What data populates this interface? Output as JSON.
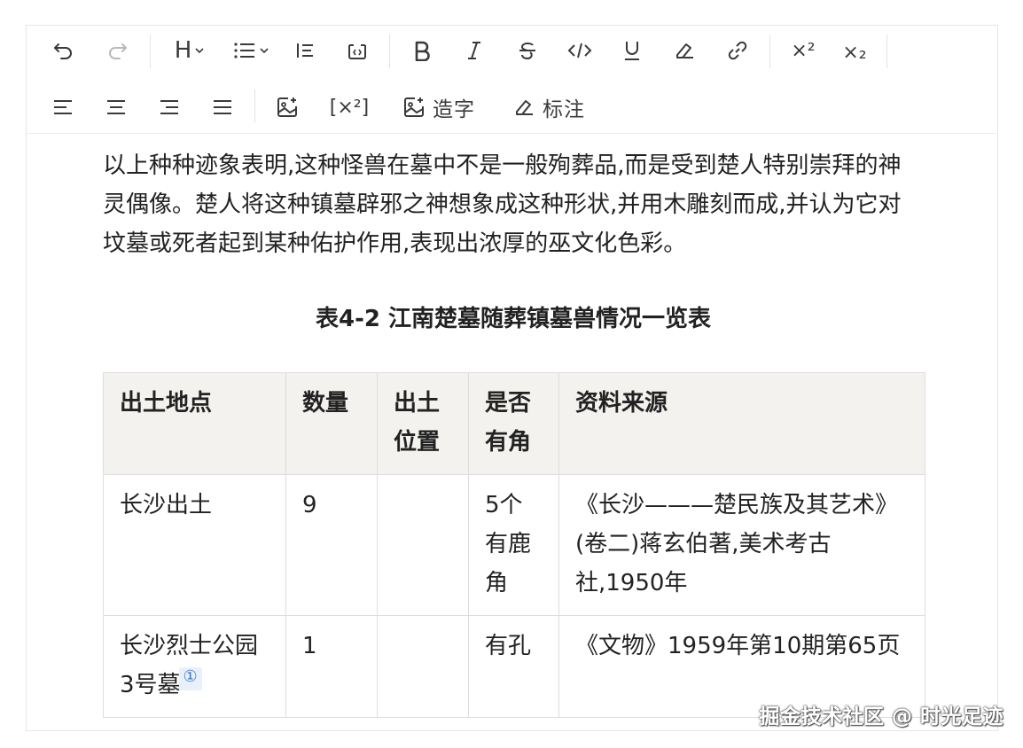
{
  "toolbar": {
    "row2": {
      "insert_formula": "[×²]",
      "make_char_label": "造字",
      "annotate_label": "标注"
    },
    "superscript": "×²",
    "subscript": "×₂",
    "heading": "H"
  },
  "content": {
    "paragraph": "以上种种迹象表明,这种怪兽在墓中不是一般殉葬品,而是受到楚人特别崇拜的神灵偶像。楚人将这种镇墓辟邪之神想象成这种形状,并用木雕刻而成,并认为它对坟墓或死者起到某种佑护作用,表现出浓厚的巫文化色彩。",
    "table_title": "表4-2 江南楚墓随葬镇墓兽情况一览表",
    "table": {
      "headers": [
        "出土地点",
        "数量",
        "出土位置",
        "是否有角",
        "资料来源"
      ],
      "rows": [
        [
          "长沙出土",
          "9",
          "",
          "5个有鹿角",
          "《长沙———楚民族及其艺术》(卷二)蒋玄伯著,美术考古社,1950年"
        ],
        [
          "长沙烈士公园3号墓",
          "1",
          "",
          "有孔",
          "《文物》1959年第10期第65页"
        ]
      ],
      "footnote_marker": "①"
    }
  },
  "watermark": "掘金技术社区 @ 时光足迹"
}
